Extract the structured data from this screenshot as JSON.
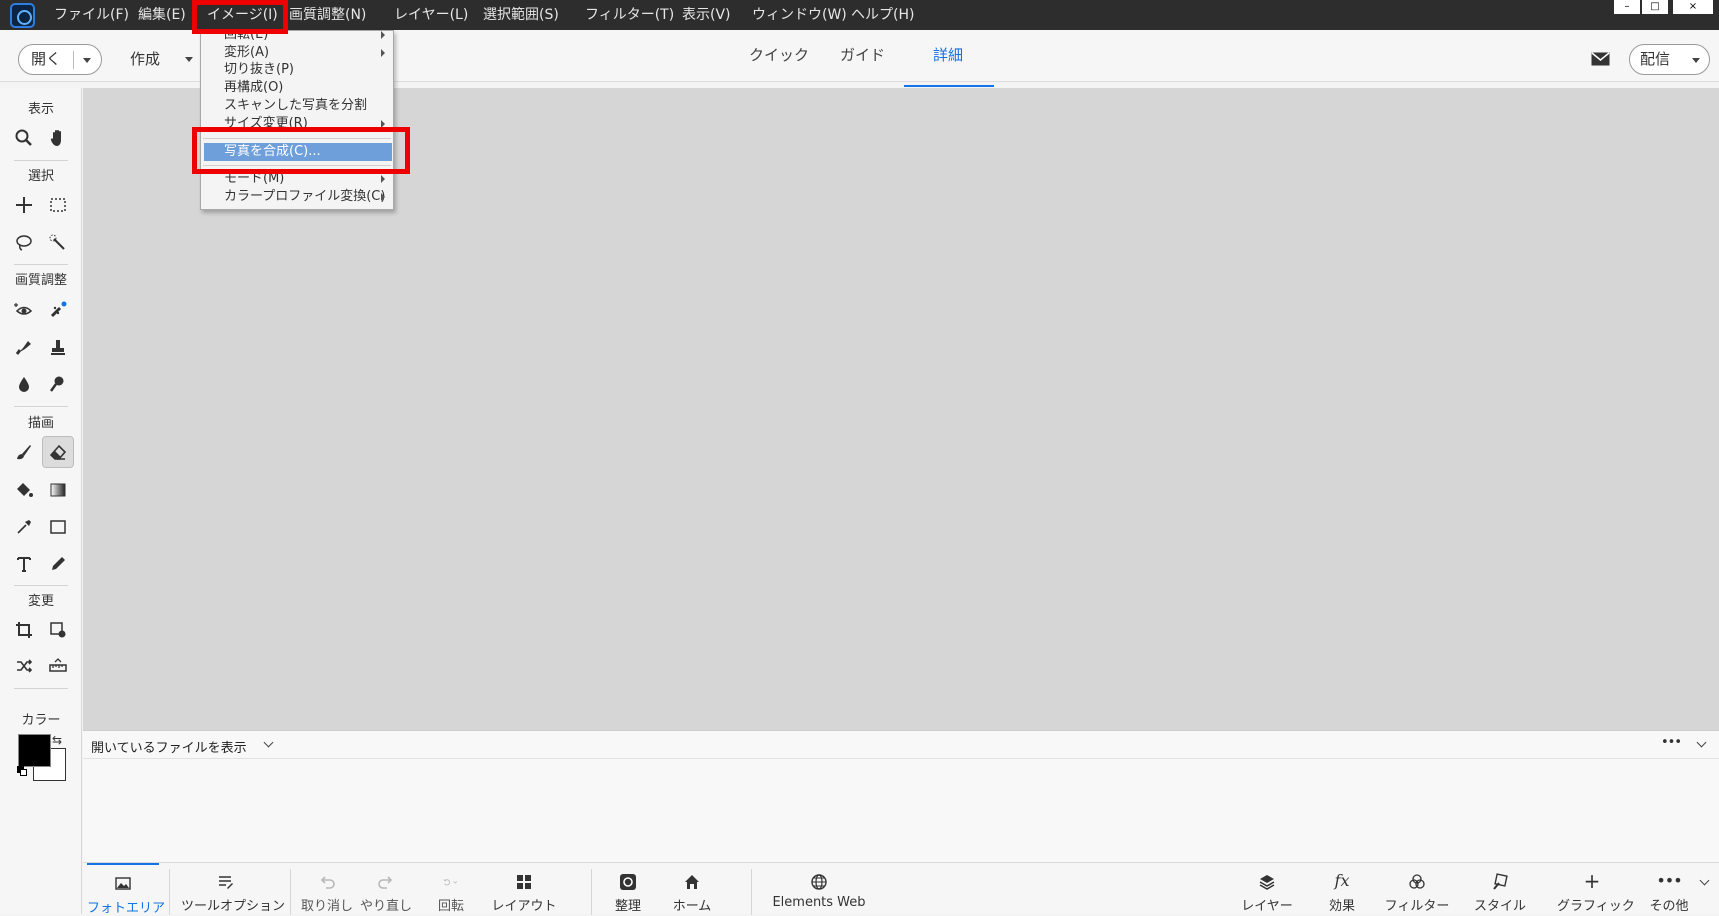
{
  "menubar": {
    "items": [
      "ファイル(F)",
      "編集(E)",
      "イメージ(I)",
      "画質調整(N)",
      "レイヤー(L)",
      "選択範囲(S)",
      "フィルター(T)",
      "表示(V)",
      "ウィンドウ(W)",
      "ヘルプ(H)"
    ],
    "window_controls": [
      "–",
      "□",
      "×"
    ]
  },
  "toolbar": {
    "open_label": "開く",
    "create_label": "作成",
    "tabs": [
      "クイック",
      "ガイド",
      "詳細"
    ],
    "active_tab": "詳細",
    "share_label": "配信"
  },
  "tool_panel": {
    "sections": [
      "表示",
      "選択",
      "画質調整",
      "描画",
      "変更",
      "カラー"
    ],
    "tools": {
      "view": [
        "zoom-icon",
        "hand-icon"
      ],
      "select": [
        "move-icon",
        "marquee-icon",
        "lasso-icon",
        "quick-selection-icon"
      ],
      "enhance": [
        "red-eye-icon",
        "spot-healing-icon",
        "smart-brush-icon",
        "clone-stamp-icon",
        "blur-icon",
        "sponge-icon"
      ],
      "draw": [
        "brush-icon",
        "eraser-icon",
        "paint-bucket-icon",
        "gradient-icon",
        "eyedropper-icon",
        "rectangle-icon",
        "type-icon",
        "pencil-icon"
      ],
      "modify": [
        "crop-icon",
        "recompose-icon",
        "content-aware-move-icon",
        "straighten-icon"
      ]
    },
    "active_tool": "eraser-icon",
    "foreground_color": "#000000",
    "background_color": "#ffffff"
  },
  "image_menu": {
    "items": [
      {
        "label": "回転(E)",
        "submenu": true
      },
      {
        "label": "変形(A)",
        "submenu": true
      },
      {
        "label": "切り抜き(P)",
        "submenu": false
      },
      {
        "label": "再構成(O)",
        "submenu": false
      },
      {
        "label": "スキャンした写真を分割",
        "submenu": false
      },
      {
        "label": "サイズ変更(R)",
        "submenu": true
      },
      {
        "label": "写真を合成(C)...",
        "submenu": false,
        "highlighted": true
      },
      {
        "label": "モード(M)",
        "submenu": true
      },
      {
        "label": "カラープロファイル変換(C)",
        "submenu": true
      }
    ]
  },
  "photo_bin": {
    "selector_label": "開いているファイルを表示",
    "more": "•••"
  },
  "taskbar": {
    "left": [
      {
        "label": "フォトエリア",
        "icon": "photo-bin-icon",
        "active": true
      },
      {
        "label": "ツールオプション",
        "icon": "tool-options-icon"
      },
      {
        "label": "取り消し",
        "icon": "undo-icon",
        "disabled": true
      },
      {
        "label": "やり直し",
        "icon": "redo-icon",
        "disabled": true
      },
      {
        "label": "回転",
        "icon": "rotate-icon",
        "disabled": true
      },
      {
        "label": "レイアウト",
        "icon": "layout-icon"
      },
      {
        "label": "整理",
        "icon": "organizer-icon"
      },
      {
        "label": "ホーム",
        "icon": "home-icon"
      },
      {
        "label": "Elements Web",
        "icon": "globe-icon"
      }
    ],
    "right": [
      {
        "label": "レイヤー",
        "icon": "layers-icon"
      },
      {
        "label": "効果",
        "icon": "effects-icon"
      },
      {
        "label": "フィルター",
        "icon": "filters-icon"
      },
      {
        "label": "スタイル",
        "icon": "styles-icon"
      },
      {
        "label": "グラフィック",
        "icon": "graphics-icon"
      },
      {
        "label": "その他",
        "icon": "more-icon"
      }
    ]
  },
  "colors": {
    "accent": "#1473e6",
    "menu_highlight": "#6e9fda",
    "annotation_red": "#ee0000",
    "canvas": "#d6d6d6",
    "menubar": "#2d2d2d"
  }
}
